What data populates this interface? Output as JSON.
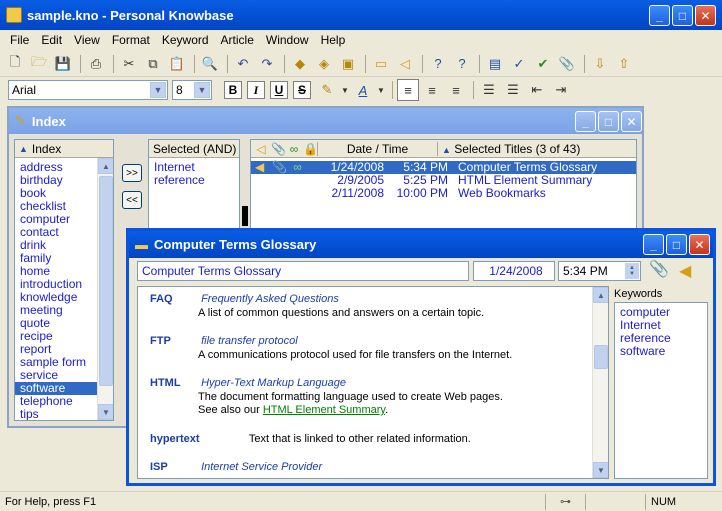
{
  "app": {
    "title": "sample.kno - Personal Knowbase"
  },
  "window_buttons": {
    "minimize": "_",
    "maximize": "□",
    "close": "✕"
  },
  "menu": [
    "File",
    "Edit",
    "View",
    "Format",
    "Keyword",
    "Article",
    "Window",
    "Help"
  ],
  "toolbar_icons": [
    "new-icon",
    "open-icon",
    "save-icon",
    "print-icon",
    "cut-icon",
    "copy-icon",
    "paste-icon",
    "find-icon",
    "undo-icon",
    "redo-icon",
    "erase-icon",
    "replace-icon",
    "reset-icon",
    "folder-icon",
    "keyword-tag-icon",
    "help-icon",
    "whats-this-icon",
    "layout-icon",
    "spellcheck-icon",
    "keyword-check-icon",
    "attachment-icon",
    "import-icon",
    "export-icon"
  ],
  "format": {
    "font": "Arial",
    "size": "8",
    "bold": "B",
    "italic": "I",
    "underline": "U",
    "strikeout": "S"
  },
  "index_window": {
    "title": "Index",
    "index_header": "Index",
    "selected_header": "Selected (AND)",
    "add_button": ">>",
    "remove_button": "<<",
    "keywords": [
      "address",
      "birthday",
      "book",
      "checklist",
      "computer",
      "contact",
      "drink",
      "family",
      "home",
      "introduction",
      "knowledge",
      "meeting",
      "quote",
      "recipe",
      "report",
      "sample form",
      "service",
      "software",
      "telephone",
      "tips"
    ],
    "selected_keyword": "software",
    "selected_and": [
      "Internet",
      "reference"
    ],
    "titles_header": {
      "datetime": "Date / Time",
      "titles": "Selected Titles (3 of 43)"
    },
    "articles": [
      {
        "date": "1/24/2008",
        "time": "5:34 PM",
        "title": "Computer Terms Glossary",
        "selected": true
      },
      {
        "date": "2/9/2005",
        "time": "5:25 PM",
        "title": "HTML Element Summary",
        "selected": false
      },
      {
        "date": "2/11/2008",
        "time": "10:00 PM",
        "title": "Web Bookmarks",
        "selected": false
      }
    ]
  },
  "article_window": {
    "title": "Computer Terms Glossary",
    "title_field": "Computer Terms Glossary",
    "date_field": "1/24/2008",
    "time_field": "5:34 PM",
    "keywords_label": "Keywords",
    "keywords": [
      "computer",
      "Internet",
      "reference",
      "software"
    ],
    "entries": [
      {
        "term": "FAQ",
        "full": "Frequently Asked Questions",
        "desc": "A list of common questions and answers on a certain topic."
      },
      {
        "term": "FTP",
        "full": "file transfer protocol",
        "desc": "A communications protocol used for file transfers on the Internet."
      },
      {
        "term": "HTML",
        "full": "Hyper-Text Markup Language",
        "desc": "The document formatting language used to create Web pages.",
        "see_also": "See also our",
        "link": "HTML Element Summary",
        "after": "."
      },
      {
        "term": "hypertext",
        "inline": "Text that is linked to other related information."
      },
      {
        "term": "ISP",
        "full": "Internet Service Provider"
      }
    ]
  },
  "status": {
    "help": "For Help, press F1",
    "num": "NUM"
  }
}
